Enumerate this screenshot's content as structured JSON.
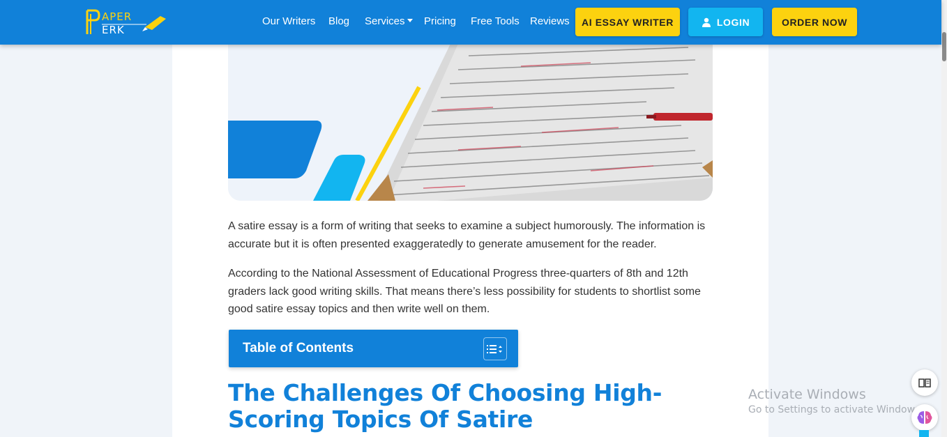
{
  "header": {
    "logo_text": "PAPER PERK",
    "nav": [
      {
        "label": "Our Writers"
      },
      {
        "label": "Blog"
      },
      {
        "label": "Services"
      },
      {
        "label": "Pricing"
      },
      {
        "label": "Free Tools"
      },
      {
        "label": "Reviews"
      }
    ],
    "buttons": {
      "ai_essay": "AI ESSAY WRITER",
      "login": "LOGIN",
      "order": "ORDER NOW"
    }
  },
  "article": {
    "paragraphs": [
      "A satire essay is a form of writing that seeks to examine a subject humorously. The information is accurate but it is often presented exaggeratedly to generate amusement for the reader.",
      "According to the National Assessment of Educational Progress three-quarters of 8th and 12th graders lack good writing skills. That means there’s less possibility for students to shortlist some good satire essay topics and then write well on them."
    ],
    "toc_title": "Table of Contents",
    "heading": "The Challenges Of Choosing High-Scoring Topics Of Satire"
  },
  "watermark": {
    "line1": "Activate Windows",
    "line2": "Go to Settings to activate Windows."
  },
  "colors": {
    "brand_blue": "#1181d9",
    "yellow": "#fcd20f",
    "cyan": "#12b5f0"
  }
}
